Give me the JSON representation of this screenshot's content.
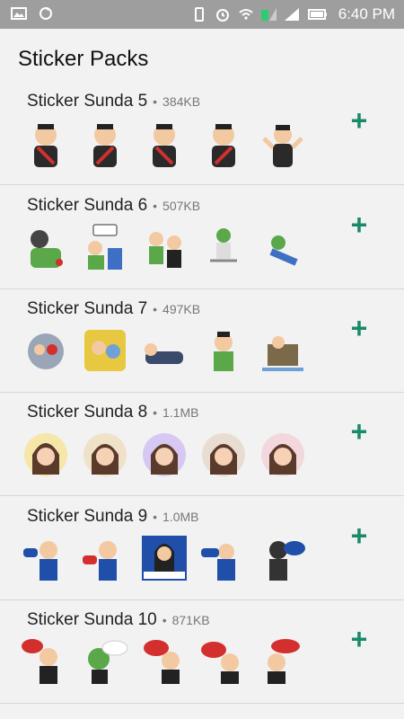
{
  "status_bar": {
    "time": "6:40 PM"
  },
  "page_title": "Sticker Packs",
  "colors": {
    "accent": "#1a8a6a",
    "statusbar": "#9e9e9e"
  },
  "packs": [
    {
      "name": "Sticker Sunda 5",
      "size": "384KB"
    },
    {
      "name": "Sticker Sunda 6",
      "size": "507KB"
    },
    {
      "name": "Sticker Sunda 7",
      "size": "497KB"
    },
    {
      "name": "Sticker Sunda 8",
      "size": "1.1MB"
    },
    {
      "name": "Sticker Sunda 9",
      "size": "1.0MB"
    },
    {
      "name": "Sticker Sunda 10",
      "size": "871KB"
    }
  ],
  "add_label": "+"
}
